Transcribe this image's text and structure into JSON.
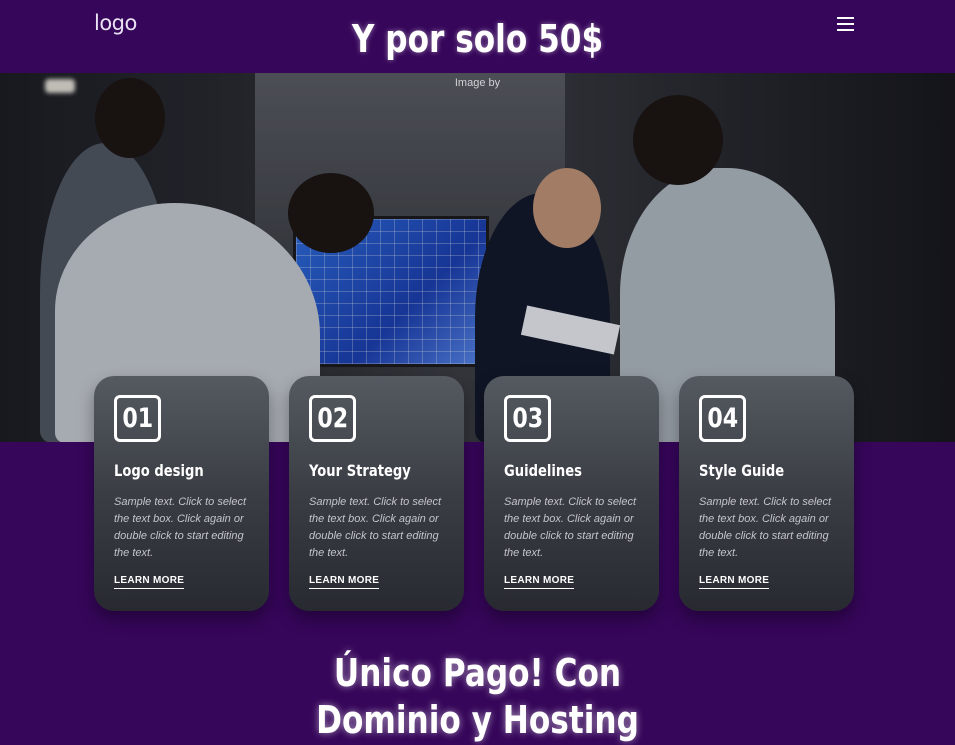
{
  "header": {
    "logo": "logo",
    "headline": "Y por solo 50$",
    "menu_icon": "hamburger-menu-icon"
  },
  "hero": {
    "credit": "Image by"
  },
  "cards": [
    {
      "number": "01",
      "title": "Logo design",
      "text": "Sample text. Click to select the text box. Click again or double click to start editing the text.",
      "link": "LEARN MORE"
    },
    {
      "number": "02",
      "title": "Your Strategy",
      "text": "Sample text. Click to select the text box. Click again or double click to start editing the text.",
      "link": "LEARN MORE"
    },
    {
      "number": "03",
      "title": "Guidelines",
      "text": "Sample text. Click to select the text box. Click again or double click to start editing the text.",
      "link": "LEARN MORE"
    },
    {
      "number": "04",
      "title": "Style Guide",
      "text": "Sample text. Click to select the text box. Click again or double click to start editing the text.",
      "link": "LEARN MORE"
    }
  ],
  "bottom": {
    "line1": "Único Pago!  Con",
    "line2": "Dominio y Hosting"
  },
  "colors": {
    "background": "#36065a",
    "card": "#3a3e44",
    "text": "#ffffff"
  }
}
